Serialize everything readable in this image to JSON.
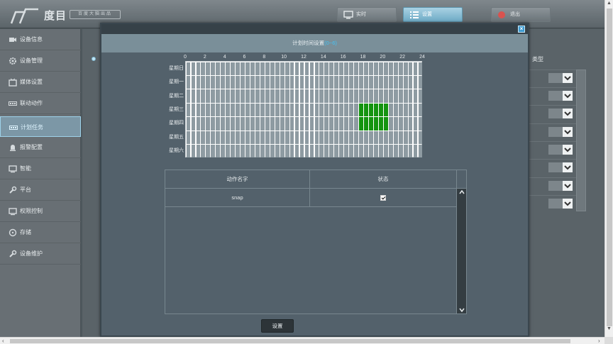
{
  "brand": {
    "name": "度目",
    "slogan": "百度大脑出品"
  },
  "nav": {
    "live_label": "实时",
    "settings_label": "设置",
    "logout_label": "退出"
  },
  "sidebar": {
    "items": [
      {
        "label": "设备信息",
        "icon": "camera-icon"
      },
      {
        "label": "设备管理",
        "icon": "gear-icon"
      },
      {
        "label": "媒体设置",
        "icon": "media-icon"
      },
      {
        "label": "联动动作",
        "icon": "link-action-icon"
      },
      {
        "label": "计划任务",
        "icon": "schedule-icon"
      },
      {
        "label": "报警配置",
        "icon": "alarm-icon"
      },
      {
        "label": "智能",
        "icon": "monitor-icon"
      },
      {
        "label": "平台",
        "icon": "wrench-icon"
      },
      {
        "label": "权限控制",
        "icon": "monitor-icon"
      },
      {
        "label": "存储",
        "icon": "storage-icon"
      },
      {
        "label": "设备维护",
        "icon": "wrench-icon"
      }
    ],
    "active_index": 4
  },
  "background": {
    "type_header": "类型"
  },
  "dialog": {
    "title": "计划时间设置",
    "title_highlight": "(0~6)",
    "close_label": "×",
    "hours": [
      "0",
      "2",
      "4",
      "6",
      "8",
      "10",
      "12",
      "14",
      "16",
      "18",
      "20",
      "22",
      "24"
    ],
    "days": [
      "星期日",
      "星期一",
      "星期二",
      "星期三",
      "星期四",
      "星期五",
      "星期六"
    ],
    "selected_slots": [
      {
        "day_index": 3,
        "from_hour": 17.5,
        "to_hour": 20.5
      },
      {
        "day_index": 4,
        "from_hour": 17.5,
        "to_hour": 20.5
      }
    ],
    "table": {
      "columns": [
        "动作名字",
        "状态"
      ],
      "rows": [
        {
          "name": "snap",
          "checked": true
        }
      ]
    },
    "set_button_label": "设置"
  },
  "colors": {
    "accent": "#45c3f5",
    "selected_slot": "#13940f",
    "active_sidebar": "#9ed2ea"
  }
}
